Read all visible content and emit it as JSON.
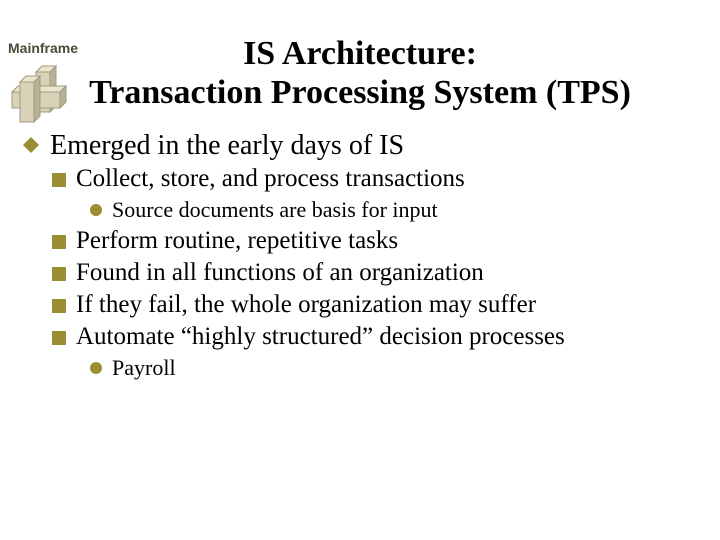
{
  "header_label": "Mainframe",
  "title_line1": "IS Architecture:",
  "title_line2": "Transaction Processing System (TPS)",
  "colors": {
    "accent": "#9a8f32"
  },
  "bullets": {
    "l1_emerged": "Emerged in the early days of IS",
    "l2_collect": "Collect, store, and process transactions",
    "l3_source": "Source documents are basis for input",
    "l2_perform": "Perform routine, repetitive tasks",
    "l2_found": "Found in all functions of an organization",
    "l2_fail": "If they fail, the whole organization may suffer",
    "l2_automate": "Automate “highly structured” decision processes",
    "l3_payroll": "Payroll"
  }
}
